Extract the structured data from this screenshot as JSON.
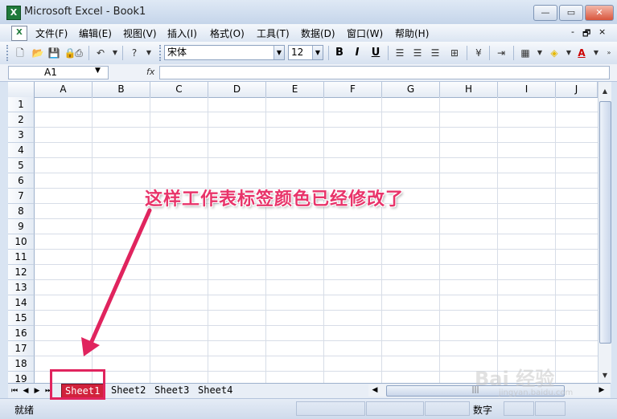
{
  "window": {
    "title": "Microsoft Excel - Book1",
    "app_icon": "excel-icon"
  },
  "menu": {
    "items": [
      "文件(F)",
      "编辑(E)",
      "视图(V)",
      "插入(I)",
      "格式(O)",
      "工具(T)",
      "数据(D)",
      "窗口(W)",
      "帮助(H)"
    ],
    "doc_controls": [
      "-",
      "🗗",
      "×"
    ]
  },
  "toolbar": {
    "font_name": "宋体",
    "font_size": "12",
    "bold": "B",
    "italic": "I",
    "underline": "U",
    "font_color_label": "A"
  },
  "formula_bar": {
    "name_box": "A1",
    "fx": "fx",
    "content": ""
  },
  "grid": {
    "columns": [
      "A",
      "B",
      "C",
      "D",
      "E",
      "F",
      "G",
      "H",
      "I",
      "J"
    ],
    "rows": [
      "1",
      "2",
      "3",
      "4",
      "5",
      "6",
      "7",
      "8",
      "9",
      "10",
      "11",
      "12",
      "13",
      "14",
      "15",
      "16",
      "17",
      "18",
      "19"
    ]
  },
  "sheets": {
    "tabs": [
      "Sheet1",
      "Sheet2",
      "Sheet3",
      "Sheet4"
    ],
    "active": "Sheet1",
    "active_tab_color": "#d1223c"
  },
  "status": {
    "ready": "就绪",
    "num_mode": "数字"
  },
  "annotation": {
    "text": "这样工作表标签颜色已经修改了",
    "color": "#e0245e"
  },
  "watermark": {
    "main": "Bai 经验",
    "sub": "jingyan.baidu.com"
  }
}
